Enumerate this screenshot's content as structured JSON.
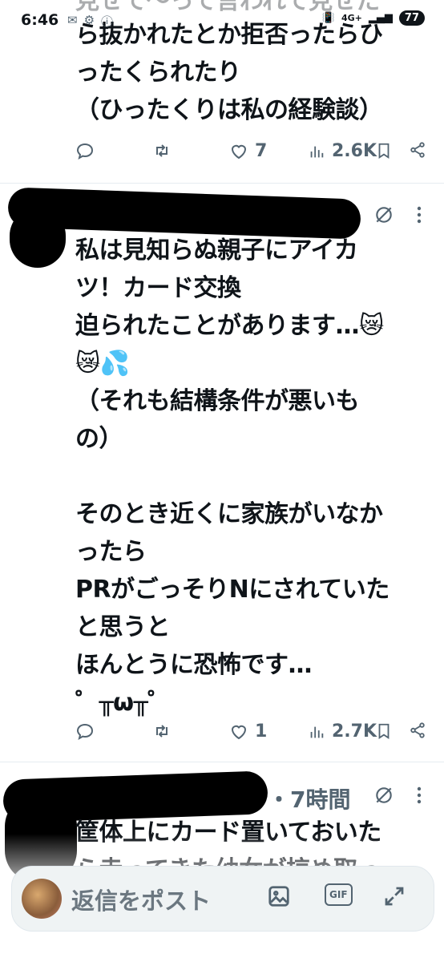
{
  "status_bar": {
    "time": "6:46",
    "network": "4G+",
    "battery": "77"
  },
  "tweets": [
    {
      "text_partial_top": "見せて〜って言われて見せた",
      "text": "ら抜かれたとか拒否ったらひ\nったくられたり\n（ひったくりは私の経験談）",
      "replies": "",
      "reposts": "",
      "likes": "7",
      "views": "2.6K"
    },
    {
      "text": "私は見知らぬ親子にアイカ\nツ！カード交換\n迫られたことがあります…😿\n😿💦\n（それも結構条件が悪いも\nの）\n\nそのとき近くに家族がいなか\nったら\nPRがごっそりNにされていた\nと思うと\nほんとうに恐怖です…\n゜╥ω╥゜",
      "likes": "1",
      "views": "2.7K"
    },
    {
      "time": "・7時間",
      "text": "筐体上にカード置いておいた\nら走ってきた幼女が掠め取っ"
    }
  ],
  "reply_bar": {
    "placeholder": "返信をポスト",
    "gif_label": "GIF"
  }
}
